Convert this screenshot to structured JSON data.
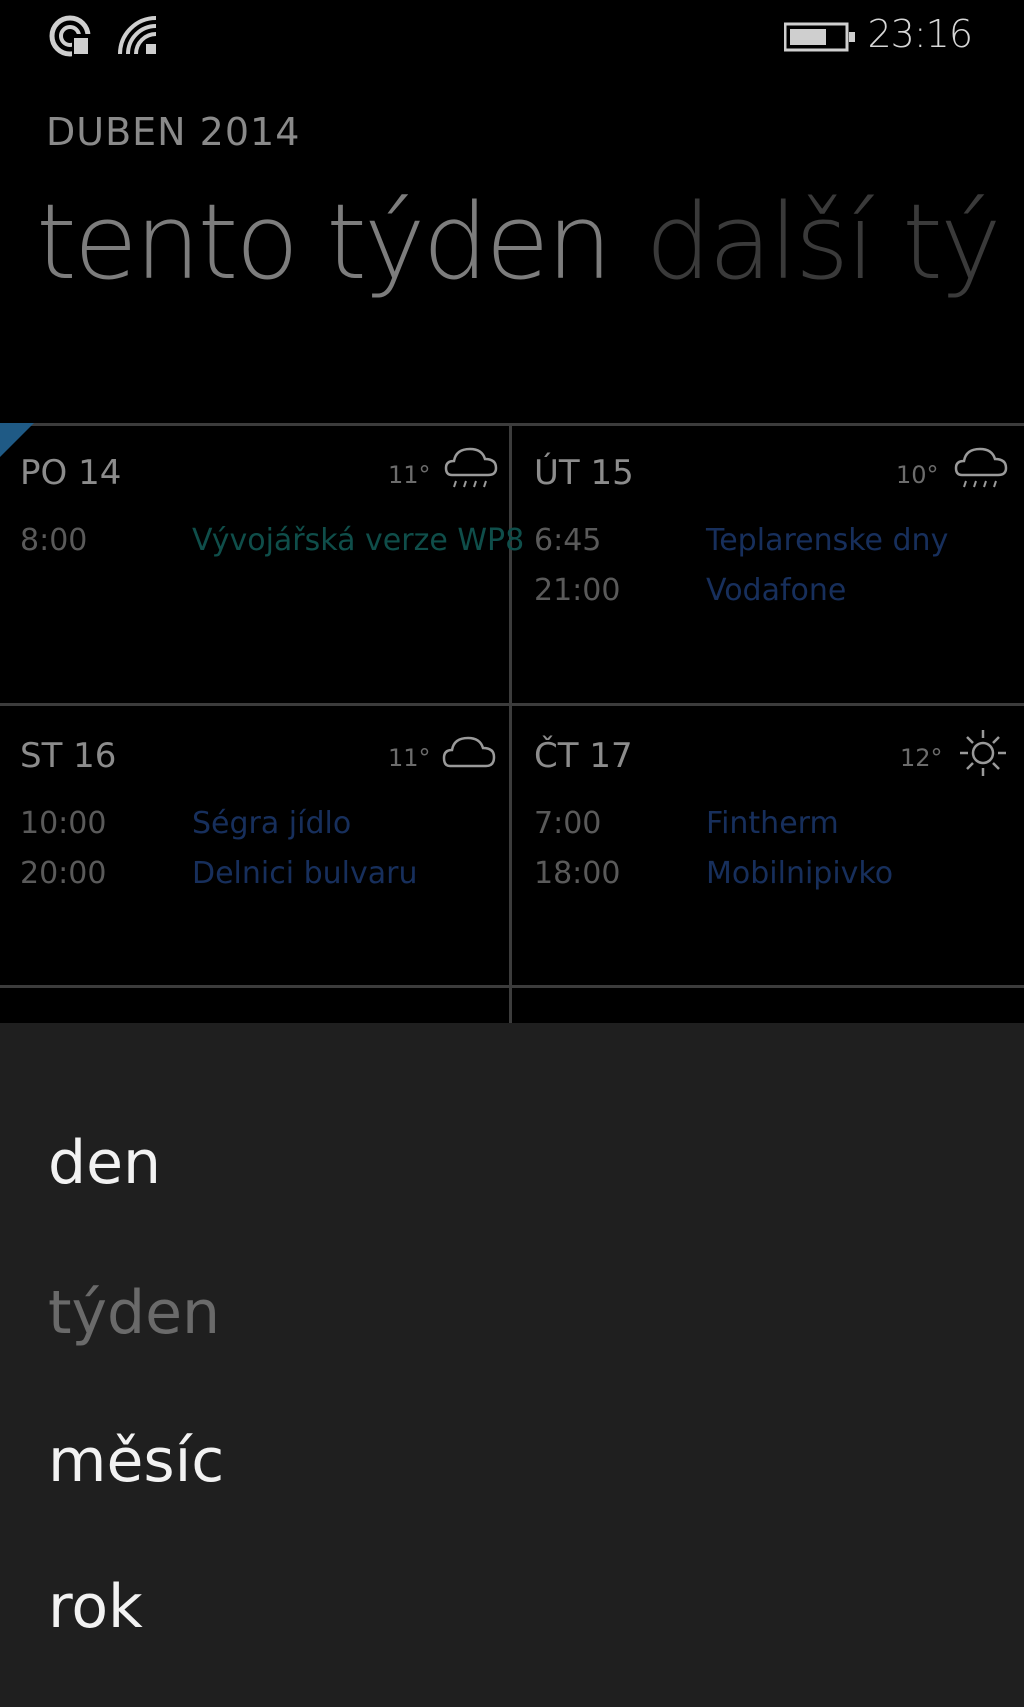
{
  "status_bar": {
    "time": "23:16",
    "icons": [
      "signal-icon",
      "wifi-icon",
      "battery-icon"
    ]
  },
  "header": {
    "month": "DUBEN 2014",
    "pivots": [
      {
        "label": "tento týden",
        "active": true
      },
      {
        "label": "další tý",
        "active": false
      }
    ]
  },
  "days": [
    {
      "label": "PO 14",
      "temp": "11°",
      "weather": "rain-cloud-icon",
      "events": [
        {
          "time": "8:00",
          "title": "Vývojářská verze WP8",
          "color": "#0f4e4a"
        }
      ]
    },
    {
      "label": "ÚT 15",
      "temp": "10°",
      "weather": "rain-cloud-icon",
      "events": [
        {
          "time": "6:45",
          "title": "Teplarenske dny",
          "color": "#172f5c"
        },
        {
          "time": "21:00",
          "title": "Vodafone",
          "color": "#172f5c"
        }
      ]
    },
    {
      "label": "ST 16",
      "temp": "11°",
      "weather": "cloud-icon",
      "events": [
        {
          "time": "10:00",
          "title": "Ségra jídlo",
          "color": "#172f5c"
        },
        {
          "time": "20:00",
          "title": "Delnici bulvaru",
          "color": "#172f5c"
        }
      ]
    },
    {
      "label": "ČT 17",
      "temp": "12°",
      "weather": "sun-icon",
      "events": [
        {
          "time": "7:00",
          "title": "Fintherm",
          "color": "#172f5c"
        },
        {
          "time": "18:00",
          "title": "Mobilnipivko",
          "color": "#172f5c"
        }
      ]
    }
  ],
  "menu": {
    "items": [
      {
        "label": "den",
        "enabled": true
      },
      {
        "label": "týden",
        "enabled": false
      },
      {
        "label": "měsíc",
        "enabled": true
      },
      {
        "label": "rok",
        "enabled": true
      }
    ]
  },
  "colors": {
    "background": "#000000",
    "menu_background": "#1f1f1f",
    "accent": "#1f5a85",
    "gridline": "#3c3c3c"
  }
}
